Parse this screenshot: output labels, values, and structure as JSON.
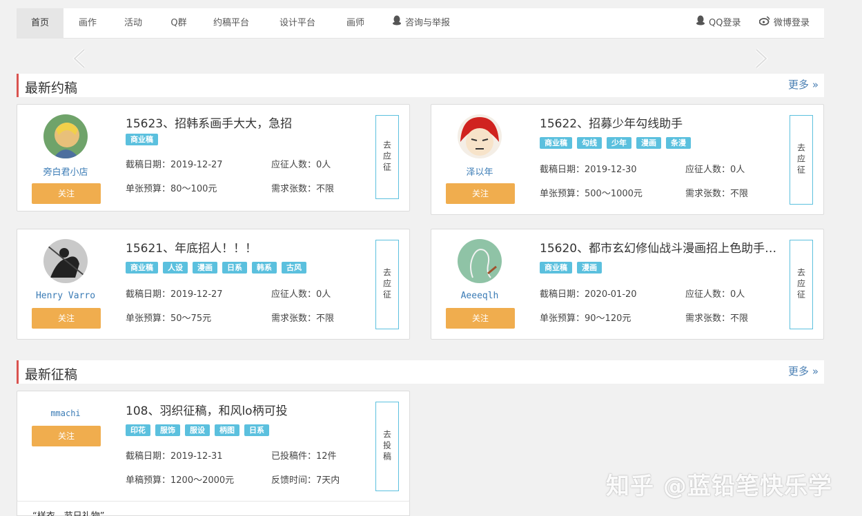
{
  "nav": {
    "items": [
      "首页",
      "画作",
      "活动",
      "Q群",
      "约稿平台",
      "设计平台",
      "画师",
      "咨询与举报"
    ],
    "qq_login": "QQ登录",
    "weibo_login": "微博登录"
  },
  "section1": {
    "title": "最新约稿",
    "more": "更多 »"
  },
  "section2": {
    "title": "最新征稿",
    "more": "更多 »"
  },
  "cards": [
    {
      "user": "旁白君小店",
      "follow": "关注",
      "title": "15623、招韩系画手大大，急招",
      "tags": [
        "商业稿"
      ],
      "deadline": "截稿日期：2019-12-27",
      "applicants": "应征人数：0人",
      "budget": "单张预算：80〜100元",
      "need": "需求张数：不限",
      "apply": "去应征"
    },
    {
      "user": "泽以年",
      "follow": "关注",
      "title": "15622、招募少年勾线助手",
      "tags": [
        "商业稿",
        "勾线",
        "少年",
        "漫画",
        "条漫"
      ],
      "deadline": "截稿日期：2019-12-30",
      "applicants": "应征人数：0人",
      "budget": "单张预算：500〜1000元",
      "need": "需求张数：不限",
      "apply": "去应征"
    },
    {
      "user": "Henry Varro",
      "follow": "关注",
      "title": "15621、年底招人！！！",
      "tags": [
        "商业稿",
        "人设",
        "漫画",
        "日系",
        "韩系",
        "古风"
      ],
      "deadline": "截稿日期：2019-12-27",
      "applicants": "应征人数：0人",
      "budget": "单张预算：50〜75元",
      "need": "需求张数：不限",
      "apply": "去应征"
    },
    {
      "user": "Aeeeqlh",
      "follow": "关注",
      "title": "15620、都市玄幻修仙战斗漫画招上色助手…",
      "tags": [
        "商业稿",
        "漫画"
      ],
      "deadline": "截稿日期：2020-01-20",
      "applicants": "应征人数：0人",
      "budget": "单张预算：90〜120元",
      "need": "需求张数：不限",
      "apply": "去应征"
    },
    {
      "user": "mmachi",
      "follow": "关注",
      "title": "108、羽织征稿，和风lo柄可投",
      "tags": [
        "印花",
        "服饰",
        "服设",
        "柄图",
        "日系"
      ],
      "deadline": "截稿日期：2019-12-31",
      "applicants": "已投稿件：12件",
      "budget": "单稿预算：1200〜2000元",
      "need": "反馈时间：7天内",
      "apply": "去投稿"
    }
  ],
  "footer_snippet": "“样衣、节日礼物”",
  "watermark": "知乎 @蓝铅笔快乐学",
  "colors": {
    "tag": "#5bc0de",
    "follow": "#f0ad4e",
    "accent_bar": "#d9534f",
    "link": "#3a7bb5"
  }
}
